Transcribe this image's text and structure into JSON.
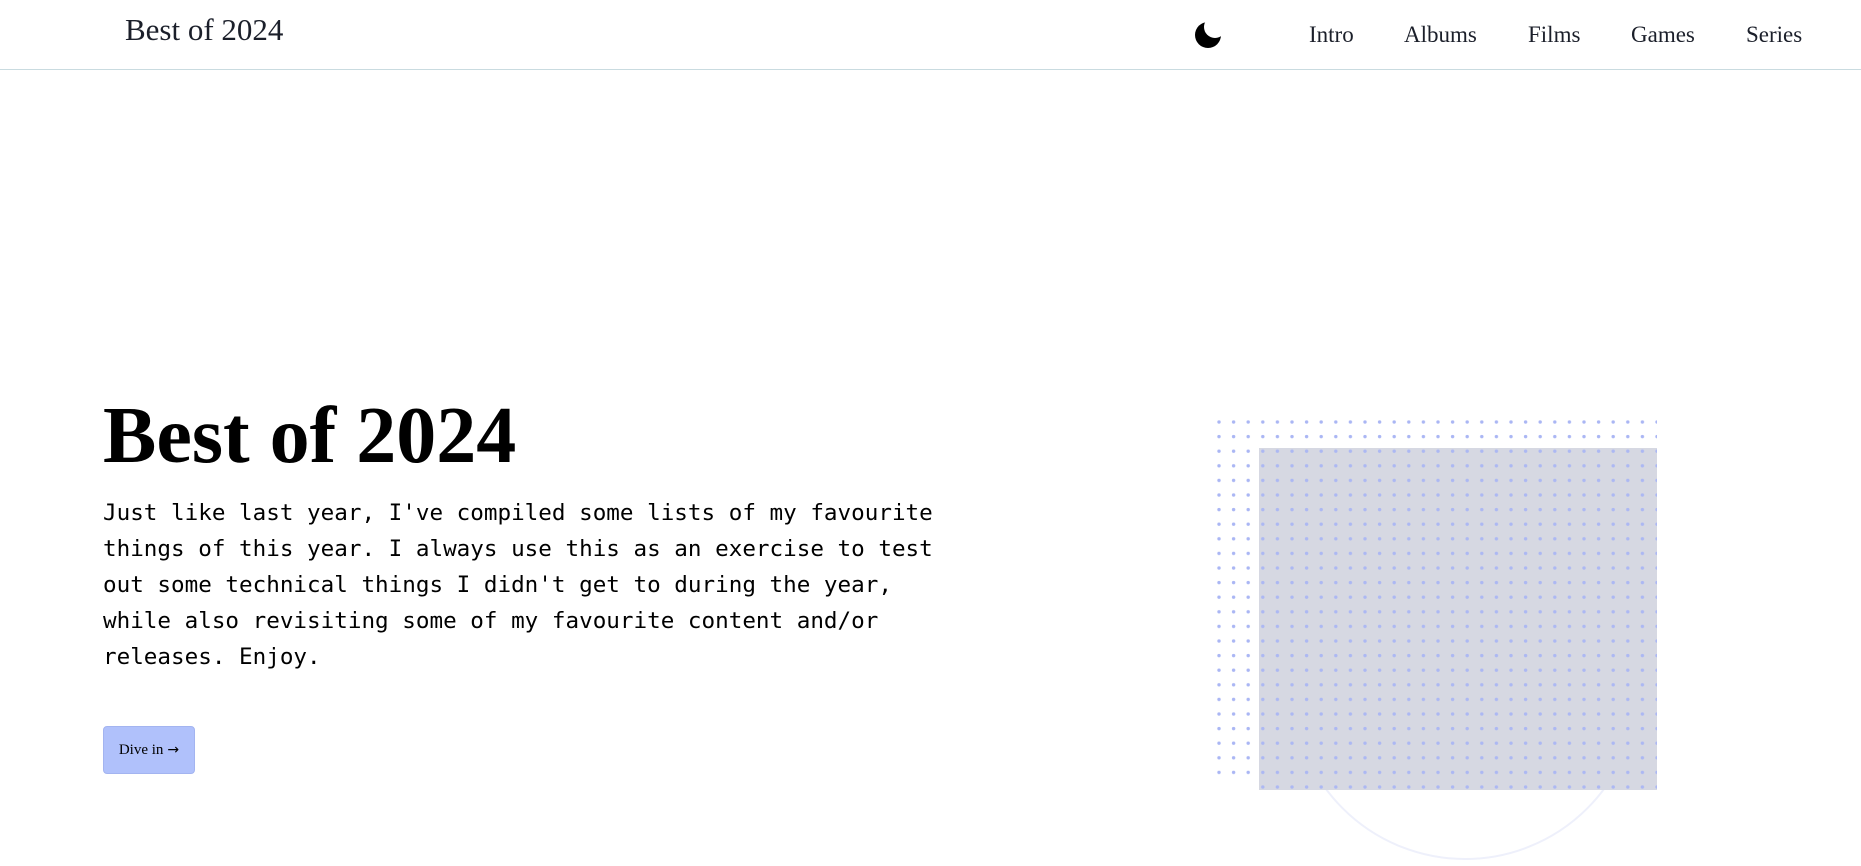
{
  "header": {
    "site_title": "Best of 2024",
    "theme_toggle_icon": "moon-icon",
    "nav": [
      {
        "id": "intro",
        "label": "Intro"
      },
      {
        "id": "albums",
        "label": "Albums"
      },
      {
        "id": "films",
        "label": "Films"
      },
      {
        "id": "games",
        "label": "Games"
      },
      {
        "id": "series",
        "label": "Series"
      }
    ]
  },
  "hero": {
    "title": "Best of 2024",
    "intro_text": "Just like last year, I've compiled some lists of my favourite things of this year. I always use this as an exercise to test out some technical things I didn't get to during the year, while also revisiting some of my favourite content and/or releases. Enjoy.",
    "cta_label": "Dive in",
    "cta_icon": "arrow-right-icon"
  },
  "colors": {
    "accent": "#b0c1fb",
    "dots": "#aab6f4",
    "image_placeholder": "#d6d8e2",
    "header_border": "#c9dbe0",
    "text_dark": "#1b1f2a"
  }
}
